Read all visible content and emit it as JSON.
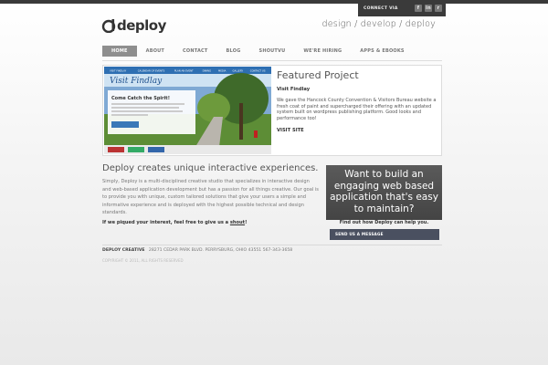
{
  "header": {
    "connect_label": "CONNECT VIA",
    "social": [
      {
        "name": "facebook-icon",
        "glyph": "f"
      },
      {
        "name": "linkedin-icon",
        "glyph": "in"
      },
      {
        "name": "rss-icon",
        "glyph": "r"
      }
    ],
    "logo_text": "deploy",
    "tagline": "design / develop / deploy"
  },
  "nav": {
    "items": [
      {
        "label": "HOME",
        "name": "nav-home",
        "active": true
      },
      {
        "label": "ABOUT",
        "name": "nav-about",
        "active": false
      },
      {
        "label": "CONTACT",
        "name": "nav-contact",
        "active": false
      },
      {
        "label": "BLOG",
        "name": "nav-blog",
        "active": false
      },
      {
        "label": "SHOUTVU",
        "name": "nav-shoutvu",
        "active": false
      },
      {
        "label": "WE'RE HIRING",
        "name": "nav-hiring",
        "active": false
      },
      {
        "label": "APPS & EBOOKS",
        "name": "nav-apps-ebooks",
        "active": false
      }
    ]
  },
  "featured": {
    "title": "Featured Project",
    "project_name": "Visit Findlay",
    "description": "We gave the Hancock County Convention & Visitors Bureau website a fresh coat of paint and supercharged their offering with an updated system built on wordpress publishing platform. Good looks and performance too!",
    "link_label": "VISIT SITE",
    "screenshot": {
      "site_logo": "Visit Findlay",
      "heading": "Come Catch the Spirit!",
      "nav": [
        "VISIT FINDLAY",
        "CALENDAR OF EVENTS",
        "PLAN AN EVENT",
        "DINING",
        "MEDIA",
        "GALLERY",
        "CONTACT US"
      ]
    }
  },
  "main": {
    "headline": "Deploy creates unique interactive experiences.",
    "intro": "Simply, Deploy is a multi-disciplined creative studio that specializes in interactive design and web-based application development but has a passion for all things creative. Our goal is to provide you with unique, custom tailored solutions that give your users a simple and informative experience and is deployed with the highest possible technical and design standards.",
    "cta_prefix": "If we piqued your interest, feel free to give us a ",
    "cta_link": "shout",
    "cta_suffix": "!"
  },
  "promo": {
    "text": "Want to build an engaging web based application that's easy to maintain?",
    "subtext": "Find out how Deploy can help you.",
    "button_label": "SEND US A MESSAGE"
  },
  "footer": {
    "company": "DEPLOY CREATIVE",
    "address": "28271 CEDAR PARK BLVD.  PERRYSBURG, OHIO 43551  567-343-3658",
    "copyright": "COPYRIGHT © 2011, ALL RIGHTS RESERVED"
  },
  "colors": {
    "nav_active": "#8e8e8e",
    "promo_bg": "#4f4f4f",
    "button_bg": "#4a5060"
  }
}
